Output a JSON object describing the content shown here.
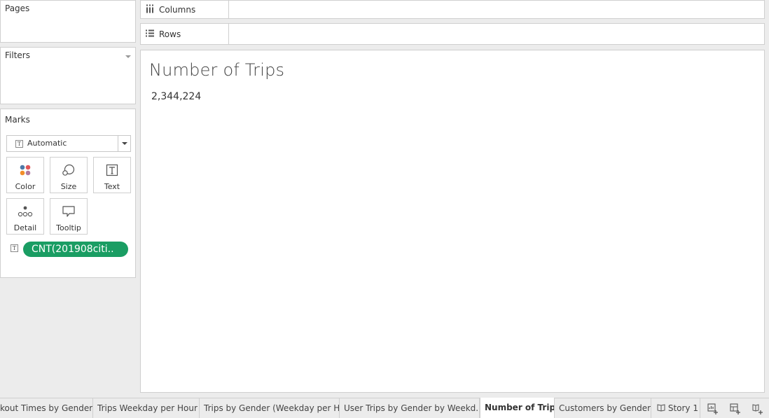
{
  "pages": {
    "title": "Pages"
  },
  "filters": {
    "title": "Filters"
  },
  "marks": {
    "title": "Marks",
    "mark_type": "Automatic",
    "buttons": [
      {
        "label": "Color",
        "icon": "color-icon"
      },
      {
        "label": "Size",
        "icon": "size-icon"
      },
      {
        "label": "Text",
        "icon": "text-icon"
      },
      {
        "label": "Detail",
        "icon": "detail-icon"
      },
      {
        "label": "Tooltip",
        "icon": "tooltip-icon"
      }
    ],
    "pill": "CNT(201908citi.."
  },
  "shelves": {
    "columns": "Columns",
    "rows": "Rows"
  },
  "viz": {
    "title": "Number of Trips",
    "value": "2,344,224"
  },
  "tabs": [
    {
      "label": "kout Times by Gender"
    },
    {
      "label": "Trips Weekday per Hour"
    },
    {
      "label": "Trips by Gender (Weekday per H..."
    },
    {
      "label": "User Trips by Gender by Weekd..."
    },
    {
      "label": "Number of Trips",
      "active": true
    },
    {
      "label": "Customers by Gender"
    },
    {
      "label": "Story 1"
    }
  ],
  "colors": {
    "pill": "#1a9d63",
    "color_dots": [
      "#4e79a7",
      "#f28e2b",
      "#e15759",
      "#b07aa1"
    ]
  }
}
